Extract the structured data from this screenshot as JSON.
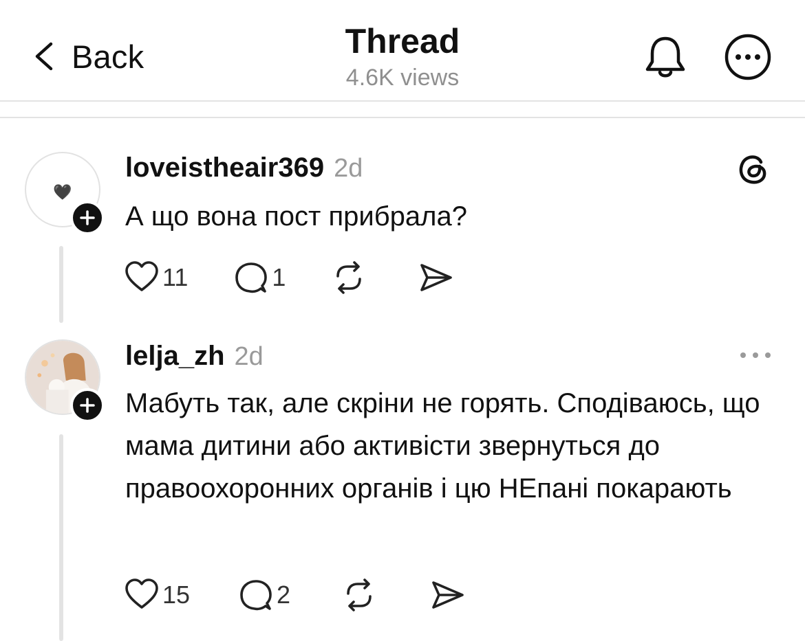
{
  "header": {
    "back_label": "Back",
    "title": "Thread",
    "views": "4.6K views",
    "icons": [
      "chevron-left-icon",
      "bell-icon",
      "more-circle-icon"
    ]
  },
  "posts": [
    {
      "username": "loveistheair369",
      "time": "2d",
      "avatar_glyph": "🖤",
      "text": "А що вона пост прибрала?",
      "likes": "11",
      "replies": "1",
      "corner_icon": "threads-logo-icon"
    },
    {
      "username": "lelja_zh",
      "time": "2d",
      "text": "Мабуть так, але скріни не горять. Сподіваюсь, що мама дитини або активісти звернуться до правоохоронних органів і цю НЕпані покарають",
      "likes": "15",
      "replies": "2",
      "corner_icon": "more-dots-icon"
    }
  ],
  "colors": {
    "text": "#111111",
    "muted": "#9a9a9a",
    "divider": "#e3e3e3",
    "background": "#ffffff"
  }
}
